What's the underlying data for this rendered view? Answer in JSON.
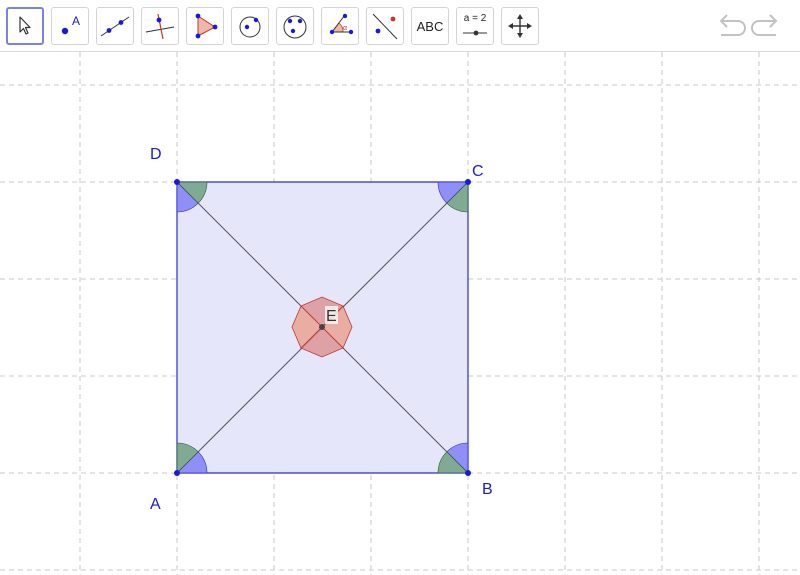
{
  "toolbar": {
    "tools": [
      {
        "name": "move-tool",
        "icon": "cursor-arrow-icon",
        "selected": true
      },
      {
        "name": "point-tool",
        "icon": "point-icon",
        "label": "A"
      },
      {
        "name": "line-tool",
        "icon": "line-through-points-icon"
      },
      {
        "name": "perpendicular-line-tool",
        "icon": "perpendicular-line-icon"
      },
      {
        "name": "polygon-tool",
        "icon": "polygon-icon"
      },
      {
        "name": "circle-center-point-tool",
        "icon": "circle-center-icon"
      },
      {
        "name": "circle-three-points-tool",
        "icon": "circle-three-points-icon"
      },
      {
        "name": "angle-tool",
        "icon": "angle-icon",
        "label": "α"
      },
      {
        "name": "reflect-tool",
        "icon": "reflect-about-line-icon"
      },
      {
        "name": "text-tool",
        "icon": "text-icon",
        "label": "ABC"
      },
      {
        "name": "slider-tool",
        "icon": "slider-icon",
        "label": "a = 2"
      },
      {
        "name": "move-graphics-view-tool",
        "icon": "move-arrows-icon"
      }
    ],
    "undo_icon": "undo-icon",
    "redo_icon": "redo-icon"
  },
  "colors": {
    "point": "#1a1ad6",
    "polygon_fill": "#e6e6fa",
    "polygon_stroke": "#2b2bd1",
    "angle_blue": "#7f7ff5",
    "angle_green": "#6f9f80",
    "angle_red": "#e07a70",
    "grid": "#c8c8c8"
  },
  "construction": {
    "points": [
      {
        "label": "A"
      },
      {
        "label": "B"
      },
      {
        "label": "C"
      },
      {
        "label": "D"
      },
      {
        "label": "E"
      }
    ]
  }
}
